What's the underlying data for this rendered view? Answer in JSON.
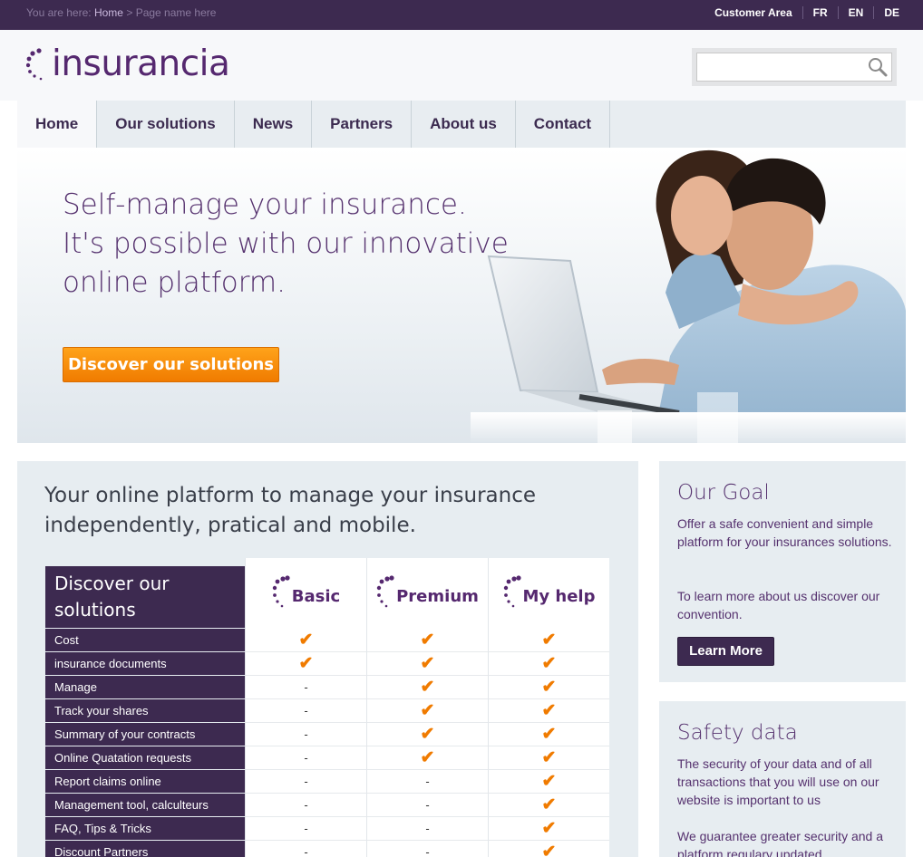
{
  "topbar": {
    "breadcrumb_prefix": "You are here:",
    "breadcrumb_home": "Home",
    "breadcrumb_sep": ">",
    "breadcrumb_page": "Page name here",
    "links": [
      "Customer Area",
      "FR",
      "EN",
      "DE"
    ]
  },
  "header": {
    "logo_text": "insurancia",
    "search_placeholder": ""
  },
  "nav": {
    "items": [
      "Home",
      "Our solutions",
      "News",
      "Partners",
      "About us",
      "Contact"
    ],
    "active": "Home"
  },
  "hero": {
    "lines": [
      "Self-manage your insurance.",
      "It's possible with our innovative",
      "online platform."
    ],
    "button_label": "Discover our solutions"
  },
  "main": {
    "title": "Your online platform to manage your insurance independently, pratical and mobile.",
    "table": {
      "header_label": "Discover our solutions",
      "plans": [
        "Basic",
        "Premium",
        "My help"
      ],
      "rows": [
        {
          "label": "Cost",
          "values": [
            "check",
            "check",
            "check"
          ]
        },
        {
          "label": "insurance documents",
          "values": [
            "check",
            "check",
            "check"
          ]
        },
        {
          "label": "Manage",
          "values": [
            "-",
            "check",
            "check"
          ]
        },
        {
          "label": "Track your shares",
          "values": [
            "-",
            "check",
            "check"
          ]
        },
        {
          "label": "Summary of your contracts",
          "values": [
            "-",
            "check",
            "check"
          ]
        },
        {
          "label": "Online Quatation requests",
          "values": [
            "-",
            "check",
            "check"
          ]
        },
        {
          "label": "Report claims online",
          "values": [
            "-",
            "-",
            "check"
          ]
        },
        {
          "label": "Management tool, calculteurs",
          "values": [
            "-",
            "-",
            "check"
          ]
        },
        {
          "label": "FAQ, Tips & Tricks",
          "values": [
            "-",
            "-",
            "check"
          ]
        },
        {
          "label": "Discount Partners",
          "values": [
            "-",
            "-",
            "check"
          ]
        }
      ],
      "check_glyph": "✔",
      "dash_glyph": "-"
    }
  },
  "goal": {
    "title": "Our Goal",
    "para1": "Offer a safe convenient and simple platform for your insurances solutions.",
    "para2": "To learn more about us discover our convention.",
    "button_label": "Learn More"
  },
  "safety": {
    "title": "Safety data",
    "para1": "The security of your data and of all transactions that you will use on our website is important to us",
    "para2": "We guarantee greater security and a platform regulary updated."
  },
  "colors": {
    "brand_purple": "#55286f",
    "dark_purple": "#3d2a50",
    "accent_orange": "#f07b00",
    "panel_bg": "#e7edf1"
  }
}
